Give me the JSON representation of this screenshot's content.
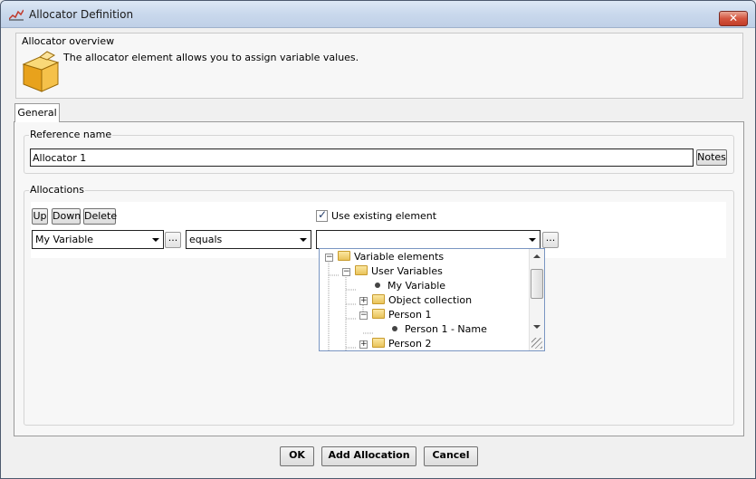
{
  "window": {
    "title": "Allocator Definition",
    "close_label": "✕"
  },
  "overview": {
    "title": "Allocator overview",
    "description": "The allocator element allows you to assign variable values."
  },
  "tabs": [
    {
      "label": "General"
    }
  ],
  "reference": {
    "group_title": "Reference name",
    "value": "Allocator 1",
    "notes_label": "Notes"
  },
  "allocations": {
    "group_title": "Allocations",
    "up_label": "Up",
    "down_label": "Down",
    "delete_label": "Delete",
    "use_existing_label": "Use existing element",
    "use_existing_checked": true,
    "variable_value": "My Variable",
    "operator_value": "equals",
    "element_value": "",
    "ellipsis_label": "..."
  },
  "tree": {
    "items": [
      {
        "label": "Variable elements",
        "kind": "folder",
        "expanded": true
      },
      {
        "label": "User Variables",
        "kind": "folder",
        "expanded": true
      },
      {
        "label": "My Variable",
        "kind": "leaf"
      },
      {
        "label": "Object collection",
        "kind": "folder",
        "expanded": false
      },
      {
        "label": "Person 1",
        "kind": "folder",
        "expanded": true
      },
      {
        "label": "Person 1 - Name",
        "kind": "leaf"
      },
      {
        "label": "Person 2",
        "kind": "folder",
        "expanded": false
      }
    ]
  },
  "footer": {
    "ok_label": "OK",
    "add_allocation_label": "Add Allocation",
    "cancel_label": "Cancel"
  }
}
